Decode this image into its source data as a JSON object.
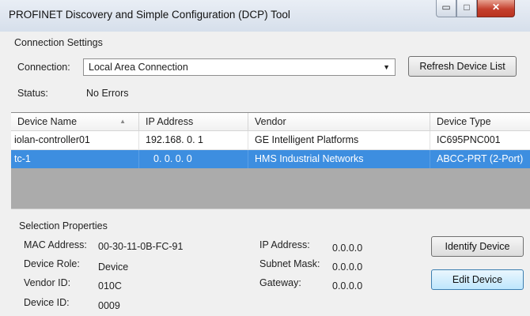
{
  "window": {
    "title": "PROFINET Discovery and Simple Configuration (DCP) Tool",
    "min_glyph": "▭",
    "max_glyph": "□",
    "close_glyph": "✕"
  },
  "connection": {
    "group_label": "Connection Settings",
    "connection_label": "Connection:",
    "connection_value": "Local Area Connection",
    "refresh_label": "Refresh Device List",
    "status_label": "Status:",
    "status_value": "No Errors"
  },
  "devices": {
    "columns": [
      "Device Name",
      "IP Address",
      "Vendor",
      "Device Type"
    ],
    "rows": [
      {
        "name": "iolan-controller01",
        "ip": "192.168.  0.  1",
        "vendor": "GE Intelligent Platforms",
        "type": "IC695PNC001"
      },
      {
        "name": "tc-1",
        "ip": "0.  0.  0.  0",
        "vendor": "HMS Industrial Networks",
        "type": "ABCC-PRT (2-Port)"
      }
    ],
    "selected_index": 1
  },
  "selection": {
    "group_label": "Selection Properties",
    "mac_label": "MAC Address:",
    "mac_value": "00-30-11-0B-FC-91",
    "role_label": "Device Role:",
    "role_value": "Device",
    "vendor_id_label": "Vendor ID:",
    "vendor_id_value": "010C",
    "device_id_label": "Device ID:",
    "device_id_value": "0009",
    "ip_label": "IP Address:",
    "ip_value": "0.0.0.0",
    "subnet_label": "Subnet Mask:",
    "subnet_value": "0.0.0.0",
    "gateway_label": "Gateway:",
    "gateway_value": "0.0.0.0",
    "identify_label": "Identify Device",
    "edit_label": "Edit Device"
  },
  "colors": {
    "selection_blue": "#3d8ee0",
    "close_red": "#c4402e"
  }
}
